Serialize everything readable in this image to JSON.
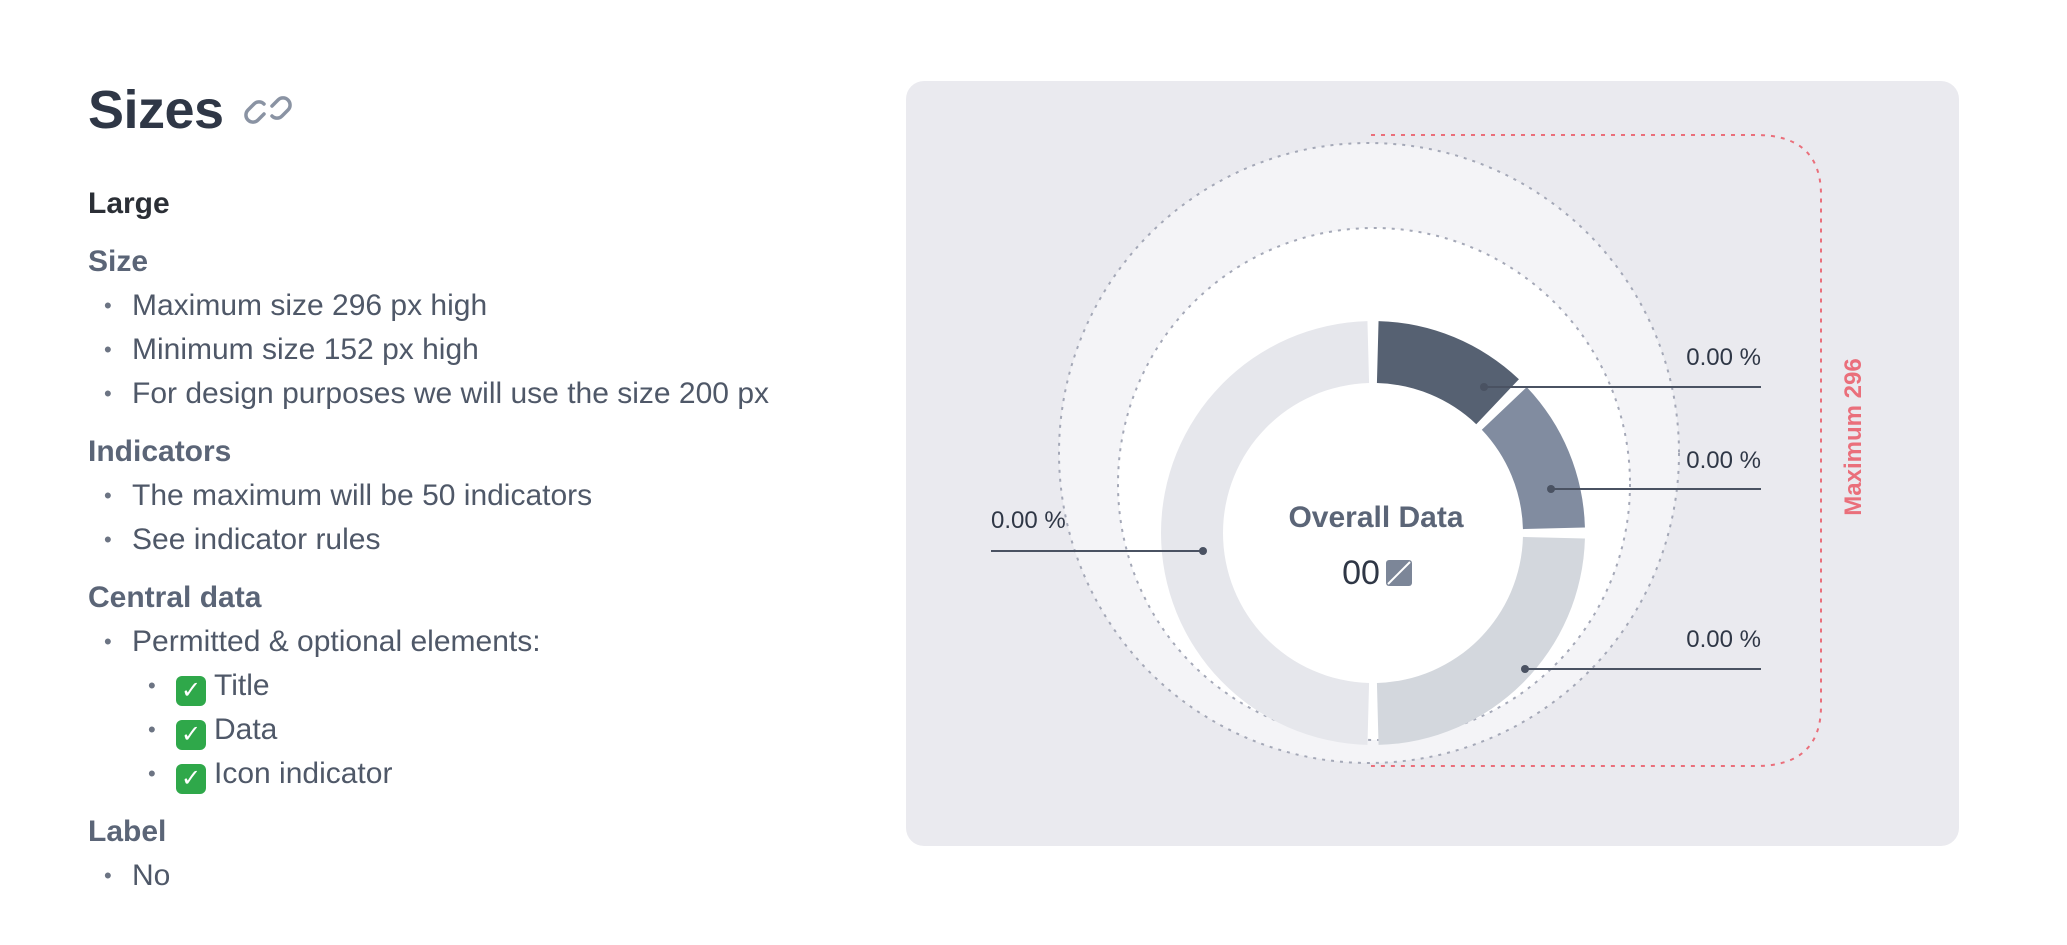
{
  "header": {
    "title": "Sizes",
    "link_icon": "link-icon"
  },
  "variant": "Large",
  "sections": [
    {
      "heading": "Size",
      "items": [
        {
          "text": "Maximum size 296 px high"
        },
        {
          "text": "Minimum size 152 px high"
        },
        {
          "text": "For design purposes we will use the size 200 px"
        }
      ]
    },
    {
      "heading": "Indicators",
      "items": [
        {
          "text": "The maximum will be 50 indicators"
        },
        {
          "text": "See indicator rules"
        }
      ]
    },
    {
      "heading": "Central data",
      "items": [
        {
          "text": "Permitted & optional elements:"
        },
        {
          "text": "Title",
          "sub": true,
          "check": true
        },
        {
          "text": "Data",
          "sub": true,
          "check": true
        },
        {
          "text": "Icon indicator",
          "sub": true,
          "check": true
        }
      ]
    },
    {
      "heading": "Label",
      "items": [
        {
          "text": "No"
        }
      ]
    }
  ],
  "diagram": {
    "center_title": "Overall Data",
    "center_value": "00",
    "max_label": "Maximum 296",
    "segments": [
      {
        "label": "0.00 %",
        "color": "#566172"
      },
      {
        "label": "0.00 %",
        "color": "#818ca0"
      },
      {
        "label": "0.00 %",
        "color": "#d3d7dd"
      },
      {
        "label": "0.00 %",
        "color": "#e6e7ec"
      }
    ],
    "accent_color": "#ea6f7b"
  }
}
